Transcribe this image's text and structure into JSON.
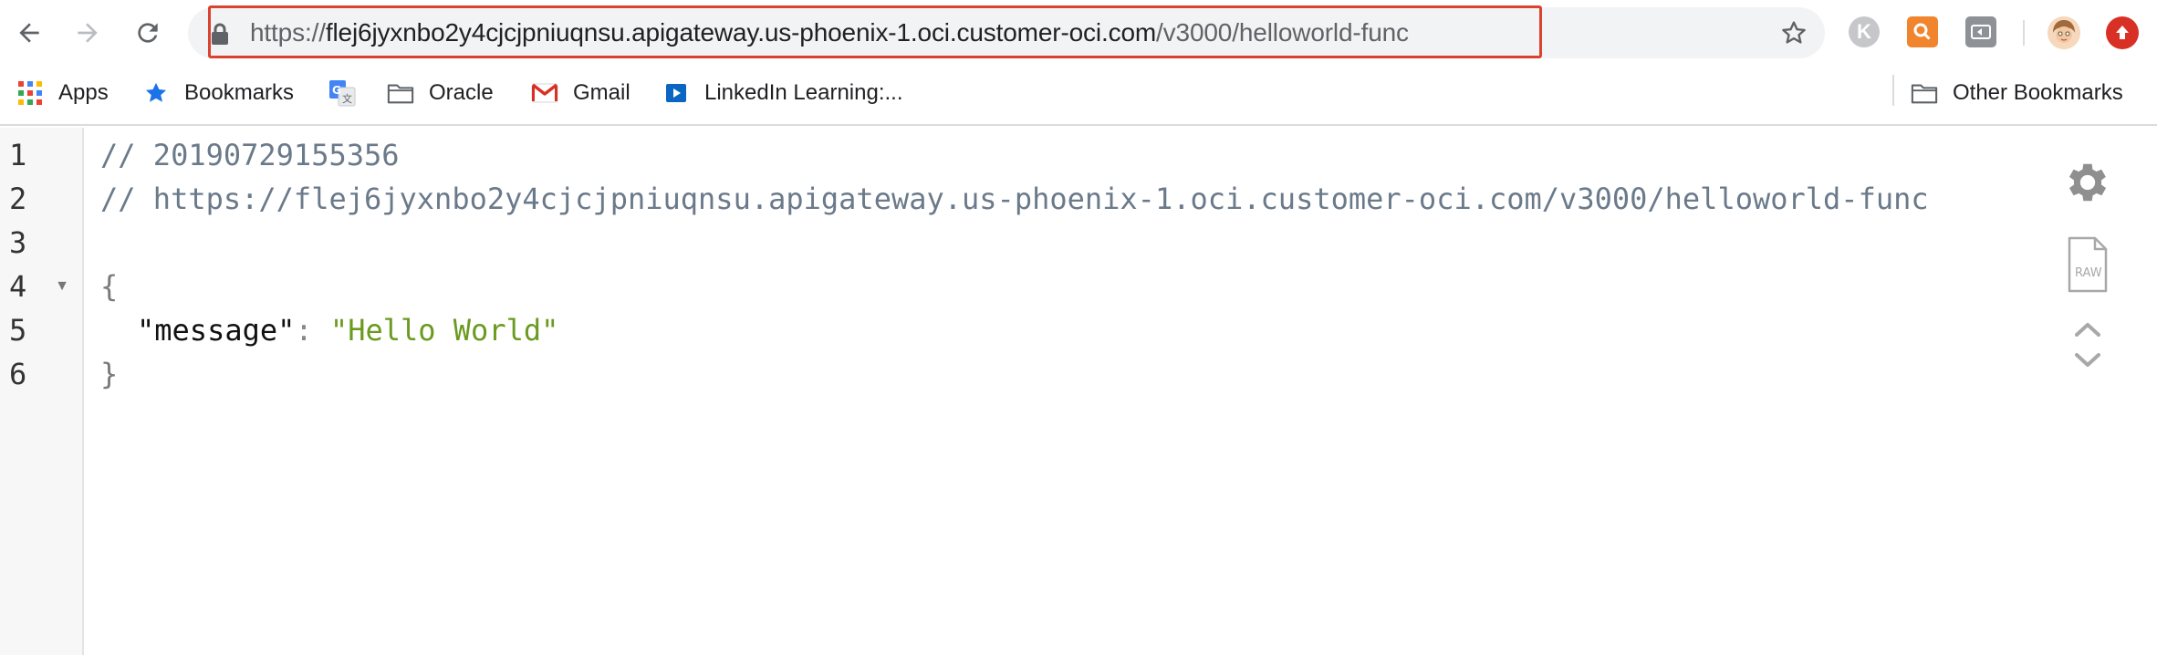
{
  "toolbar": {
    "back_label": "Back",
    "forward_label": "Forward",
    "reload_label": "Reload",
    "url_scheme": "https://",
    "url_host": "flej6jyxnbo2y4cjcjpniuqnsu.apigateway.us-phoenix-1.oci.customer-oci.com",
    "url_path": "/v3000/helloworld-func",
    "extension_k_letter": "K"
  },
  "bookmarks": {
    "items": [
      {
        "label": "Apps",
        "icon": "apps-grid-icon"
      },
      {
        "label": "Bookmarks",
        "icon": "star-icon"
      },
      {
        "label": "Oracle",
        "icon": "folder-icon"
      },
      {
        "label": "Gmail",
        "icon": "gmail-icon"
      },
      {
        "label": "LinkedIn Learning:...",
        "icon": "linkedin-learning-icon"
      }
    ],
    "other_label": "Other Bookmarks"
  },
  "editor": {
    "line_numbers": [
      "1",
      "2",
      "3",
      "4",
      "5",
      "6"
    ],
    "line1": "// 20190729155356",
    "line2": "// https://flej6jyxnbo2y4cjcjpniuqnsu.apigateway.us-phoenix-1.oci.customer-oci.com/v3000/helloworld-func",
    "open_brace": "{",
    "key": "\"message\"",
    "colon": ": ",
    "value": "\"Hello World\"",
    "close_brace": "}",
    "fold_glyph": "▼",
    "raw_label": "RAW"
  },
  "colors": {
    "highlight_border": "#d9432f",
    "comment": "#6b7a8a",
    "string": "#6a9a1f"
  }
}
